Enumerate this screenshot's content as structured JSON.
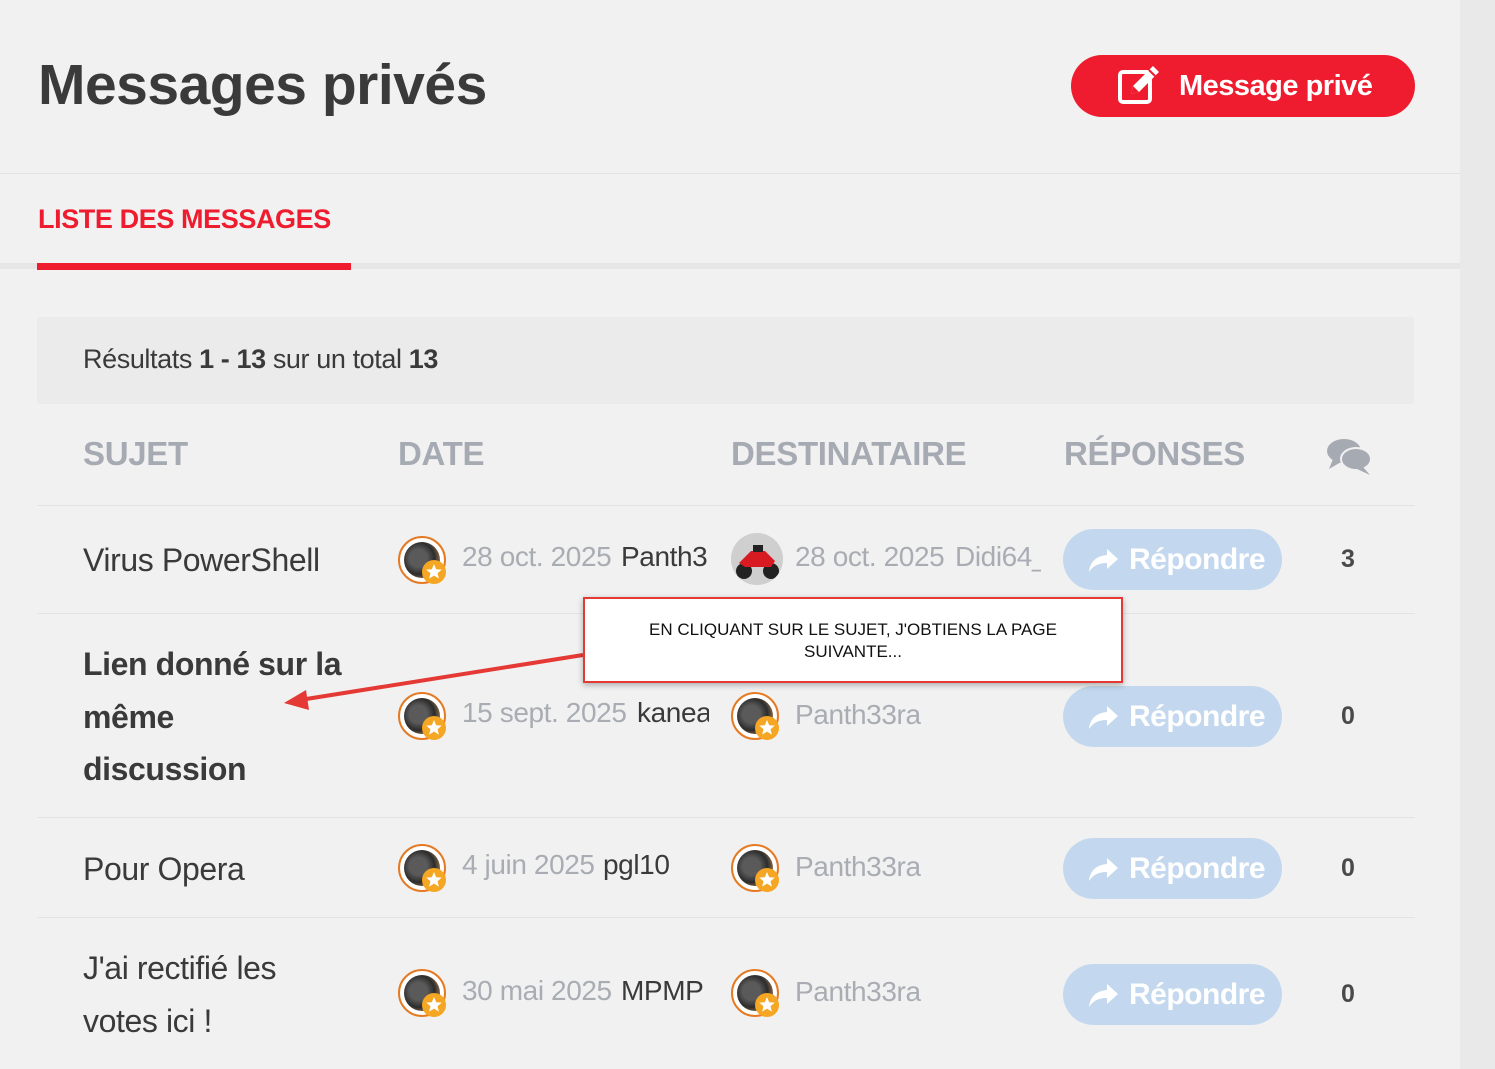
{
  "header": {
    "title": "Messages privés",
    "new_message_label": "Message privé"
  },
  "tabs": [
    {
      "label": "LISTE DES MESSAGES"
    }
  ],
  "results": {
    "prefix": "Résultats",
    "range": "1 - 13",
    "middle": "sur un total",
    "total": "13"
  },
  "table": {
    "headers": {
      "subject": "SUJET",
      "date": "DATE",
      "recipient": "DESTINATAIRE",
      "replies": "RÉPONSES"
    },
    "reply_label": "Répondre",
    "rows": [
      {
        "subject": "Virus PowerShell",
        "bold": false,
        "date": "28 oct. 2025",
        "sender": "Panth3",
        "recipient_date": "28 oct. 2025",
        "recipient": "Didi64_",
        "count": "3"
      },
      {
        "subject": "Lien donné sur la même discussion",
        "bold": true,
        "date": "15 sept. 2025",
        "sender": "kanea",
        "recipient_date": "",
        "recipient": "Panth33ra",
        "count": "0"
      },
      {
        "subject": "Pour Opera",
        "bold": false,
        "date": "4 juin 2025",
        "sender": "pgl10",
        "recipient_date": "",
        "recipient": "Panth33ra",
        "count": "0"
      },
      {
        "subject": "J'ai rectifié les votes ici !",
        "bold": false,
        "date": "30 mai 2025",
        "sender": "MPMP",
        "recipient_date": "",
        "recipient": "Panth33ra",
        "count": "0"
      }
    ]
  },
  "annotation": {
    "text": "EN CLIQUANT SUR LE SUJET, J'OBTIENS LA PAGE SUIVANTE...",
    "color": "#e53935"
  },
  "colors": {
    "accent": "#ee1c2e",
    "reply_button": "#c3d8ee",
    "avatar_ring": "#e57a23"
  },
  "icons": {
    "new_message": "pencil-square-icon",
    "comments": "comments-icon",
    "reply": "share-arrow-icon"
  }
}
